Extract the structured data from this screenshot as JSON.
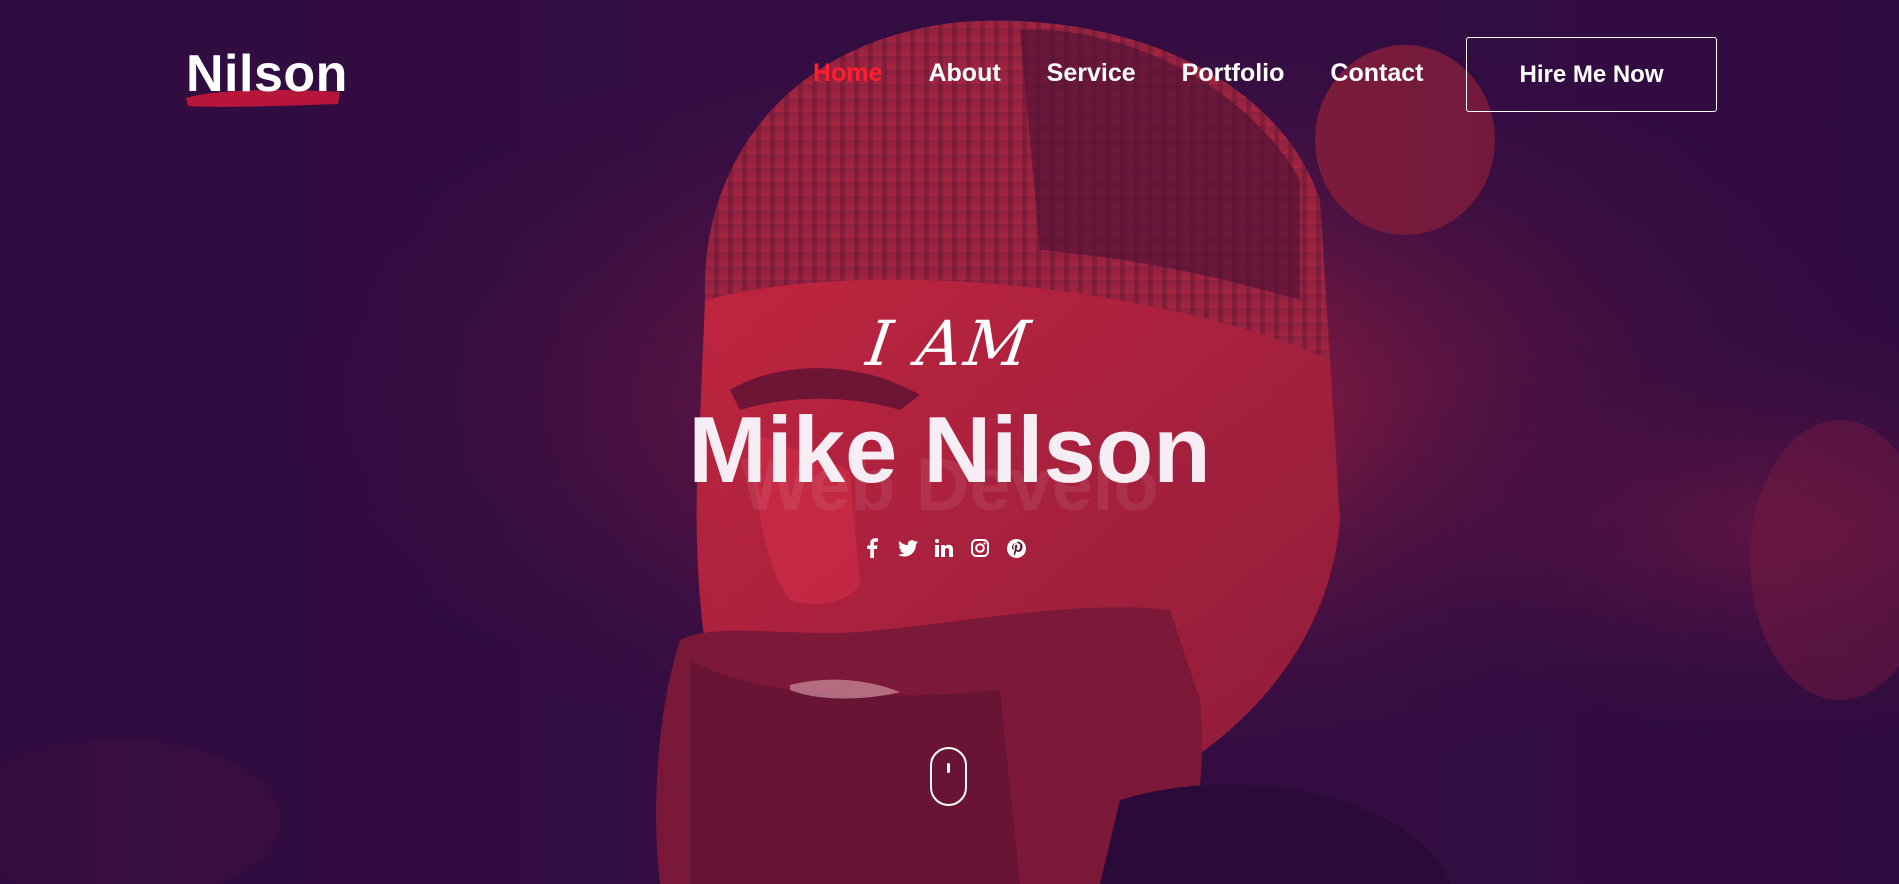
{
  "brand": {
    "logo_text": "Nilson",
    "accent_color": "#ff1f2e"
  },
  "nav": {
    "items": [
      {
        "label": "Home",
        "active": true
      },
      {
        "label": "About",
        "active": false
      },
      {
        "label": "Service",
        "active": false
      },
      {
        "label": "Portfolio",
        "active": false
      },
      {
        "label": "Contact",
        "active": false
      }
    ],
    "cta_label": "Hire Me Now"
  },
  "hero": {
    "intro": "I AM",
    "name": "Mike Nilson",
    "ghost_text": "Web Develo",
    "socials": [
      "facebook-icon",
      "twitter-icon",
      "linkedin-icon",
      "instagram-icon",
      "pinterest-icon"
    ],
    "scroll_icon": "mouse-scroll-icon"
  }
}
